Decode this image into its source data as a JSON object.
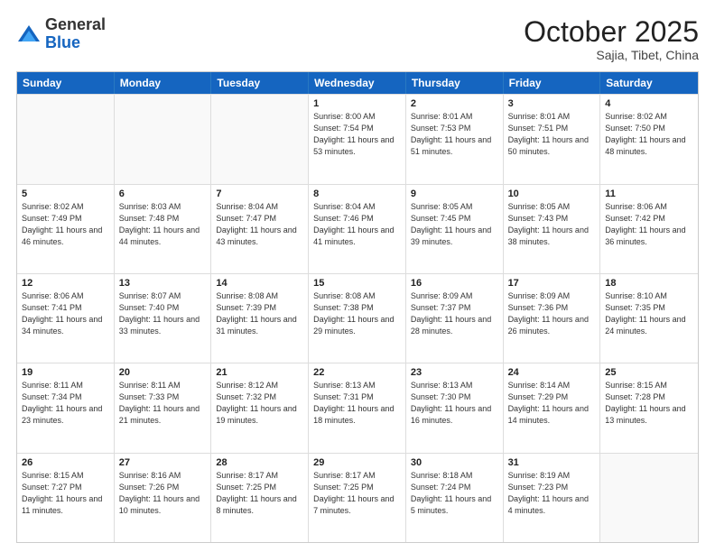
{
  "header": {
    "logo_general": "General",
    "logo_blue": "Blue",
    "month": "October 2025",
    "location": "Sajia, Tibet, China"
  },
  "weekdays": [
    "Sunday",
    "Monday",
    "Tuesday",
    "Wednesday",
    "Thursday",
    "Friday",
    "Saturday"
  ],
  "weeks": [
    [
      {
        "date": "",
        "info": ""
      },
      {
        "date": "",
        "info": ""
      },
      {
        "date": "",
        "info": ""
      },
      {
        "date": "1",
        "info": "Sunrise: 8:00 AM\nSunset: 7:54 PM\nDaylight: 11 hours\nand 53 minutes."
      },
      {
        "date": "2",
        "info": "Sunrise: 8:01 AM\nSunset: 7:53 PM\nDaylight: 11 hours\nand 51 minutes."
      },
      {
        "date": "3",
        "info": "Sunrise: 8:01 AM\nSunset: 7:51 PM\nDaylight: 11 hours\nand 50 minutes."
      },
      {
        "date": "4",
        "info": "Sunrise: 8:02 AM\nSunset: 7:50 PM\nDaylight: 11 hours\nand 48 minutes."
      }
    ],
    [
      {
        "date": "5",
        "info": "Sunrise: 8:02 AM\nSunset: 7:49 PM\nDaylight: 11 hours\nand 46 minutes."
      },
      {
        "date": "6",
        "info": "Sunrise: 8:03 AM\nSunset: 7:48 PM\nDaylight: 11 hours\nand 44 minutes."
      },
      {
        "date": "7",
        "info": "Sunrise: 8:04 AM\nSunset: 7:47 PM\nDaylight: 11 hours\nand 43 minutes."
      },
      {
        "date": "8",
        "info": "Sunrise: 8:04 AM\nSunset: 7:46 PM\nDaylight: 11 hours\nand 41 minutes."
      },
      {
        "date": "9",
        "info": "Sunrise: 8:05 AM\nSunset: 7:45 PM\nDaylight: 11 hours\nand 39 minutes."
      },
      {
        "date": "10",
        "info": "Sunrise: 8:05 AM\nSunset: 7:43 PM\nDaylight: 11 hours\nand 38 minutes."
      },
      {
        "date": "11",
        "info": "Sunrise: 8:06 AM\nSunset: 7:42 PM\nDaylight: 11 hours\nand 36 minutes."
      }
    ],
    [
      {
        "date": "12",
        "info": "Sunrise: 8:06 AM\nSunset: 7:41 PM\nDaylight: 11 hours\nand 34 minutes."
      },
      {
        "date": "13",
        "info": "Sunrise: 8:07 AM\nSunset: 7:40 PM\nDaylight: 11 hours\nand 33 minutes."
      },
      {
        "date": "14",
        "info": "Sunrise: 8:08 AM\nSunset: 7:39 PM\nDaylight: 11 hours\nand 31 minutes."
      },
      {
        "date": "15",
        "info": "Sunrise: 8:08 AM\nSunset: 7:38 PM\nDaylight: 11 hours\nand 29 minutes."
      },
      {
        "date": "16",
        "info": "Sunrise: 8:09 AM\nSunset: 7:37 PM\nDaylight: 11 hours\nand 28 minutes."
      },
      {
        "date": "17",
        "info": "Sunrise: 8:09 AM\nSunset: 7:36 PM\nDaylight: 11 hours\nand 26 minutes."
      },
      {
        "date": "18",
        "info": "Sunrise: 8:10 AM\nSunset: 7:35 PM\nDaylight: 11 hours\nand 24 minutes."
      }
    ],
    [
      {
        "date": "19",
        "info": "Sunrise: 8:11 AM\nSunset: 7:34 PM\nDaylight: 11 hours\nand 23 minutes."
      },
      {
        "date": "20",
        "info": "Sunrise: 8:11 AM\nSunset: 7:33 PM\nDaylight: 11 hours\nand 21 minutes."
      },
      {
        "date": "21",
        "info": "Sunrise: 8:12 AM\nSunset: 7:32 PM\nDaylight: 11 hours\nand 19 minutes."
      },
      {
        "date": "22",
        "info": "Sunrise: 8:13 AM\nSunset: 7:31 PM\nDaylight: 11 hours\nand 18 minutes."
      },
      {
        "date": "23",
        "info": "Sunrise: 8:13 AM\nSunset: 7:30 PM\nDaylight: 11 hours\nand 16 minutes."
      },
      {
        "date": "24",
        "info": "Sunrise: 8:14 AM\nSunset: 7:29 PM\nDaylight: 11 hours\nand 14 minutes."
      },
      {
        "date": "25",
        "info": "Sunrise: 8:15 AM\nSunset: 7:28 PM\nDaylight: 11 hours\nand 13 minutes."
      }
    ],
    [
      {
        "date": "26",
        "info": "Sunrise: 8:15 AM\nSunset: 7:27 PM\nDaylight: 11 hours\nand 11 minutes."
      },
      {
        "date": "27",
        "info": "Sunrise: 8:16 AM\nSunset: 7:26 PM\nDaylight: 11 hours\nand 10 minutes."
      },
      {
        "date": "28",
        "info": "Sunrise: 8:17 AM\nSunset: 7:25 PM\nDaylight: 11 hours\nand 8 minutes."
      },
      {
        "date": "29",
        "info": "Sunrise: 8:17 AM\nSunset: 7:25 PM\nDaylight: 11 hours\nand 7 minutes."
      },
      {
        "date": "30",
        "info": "Sunrise: 8:18 AM\nSunset: 7:24 PM\nDaylight: 11 hours\nand 5 minutes."
      },
      {
        "date": "31",
        "info": "Sunrise: 8:19 AM\nSunset: 7:23 PM\nDaylight: 11 hours\nand 4 minutes."
      },
      {
        "date": "",
        "info": ""
      }
    ]
  ]
}
